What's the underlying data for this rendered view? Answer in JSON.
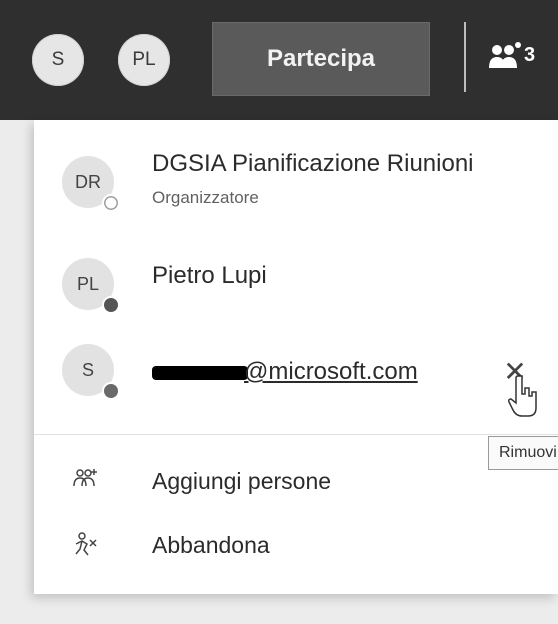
{
  "topbar": {
    "avatars": [
      {
        "initials": "S"
      },
      {
        "initials": "PL"
      }
    ],
    "join_label": "Partecipa",
    "participants_icon": "people-icon",
    "participants_count": "3"
  },
  "participants": [
    {
      "initials": "DR",
      "name": "DGSIA Pianificazione Riunioni",
      "role": "Organizzatore",
      "status": "offline"
    },
    {
      "initials": "PL",
      "name": "Pietro Lupi",
      "role": "",
      "status": "busy"
    },
    {
      "initials": "S",
      "name": "@microsoft.com",
      "role": "",
      "status": "away"
    }
  ],
  "remove": {
    "icon": "close-icon",
    "tooltip": "Rimuovi"
  },
  "actions": [
    {
      "label": "Aggiungi persone",
      "icon": "add-people-icon"
    },
    {
      "label": "Abbandona",
      "icon": "leave-icon"
    }
  ],
  "colors": {
    "topbar": "#2f2f2f",
    "join_button": "#5a5a5a",
    "panel": "#ffffff"
  }
}
